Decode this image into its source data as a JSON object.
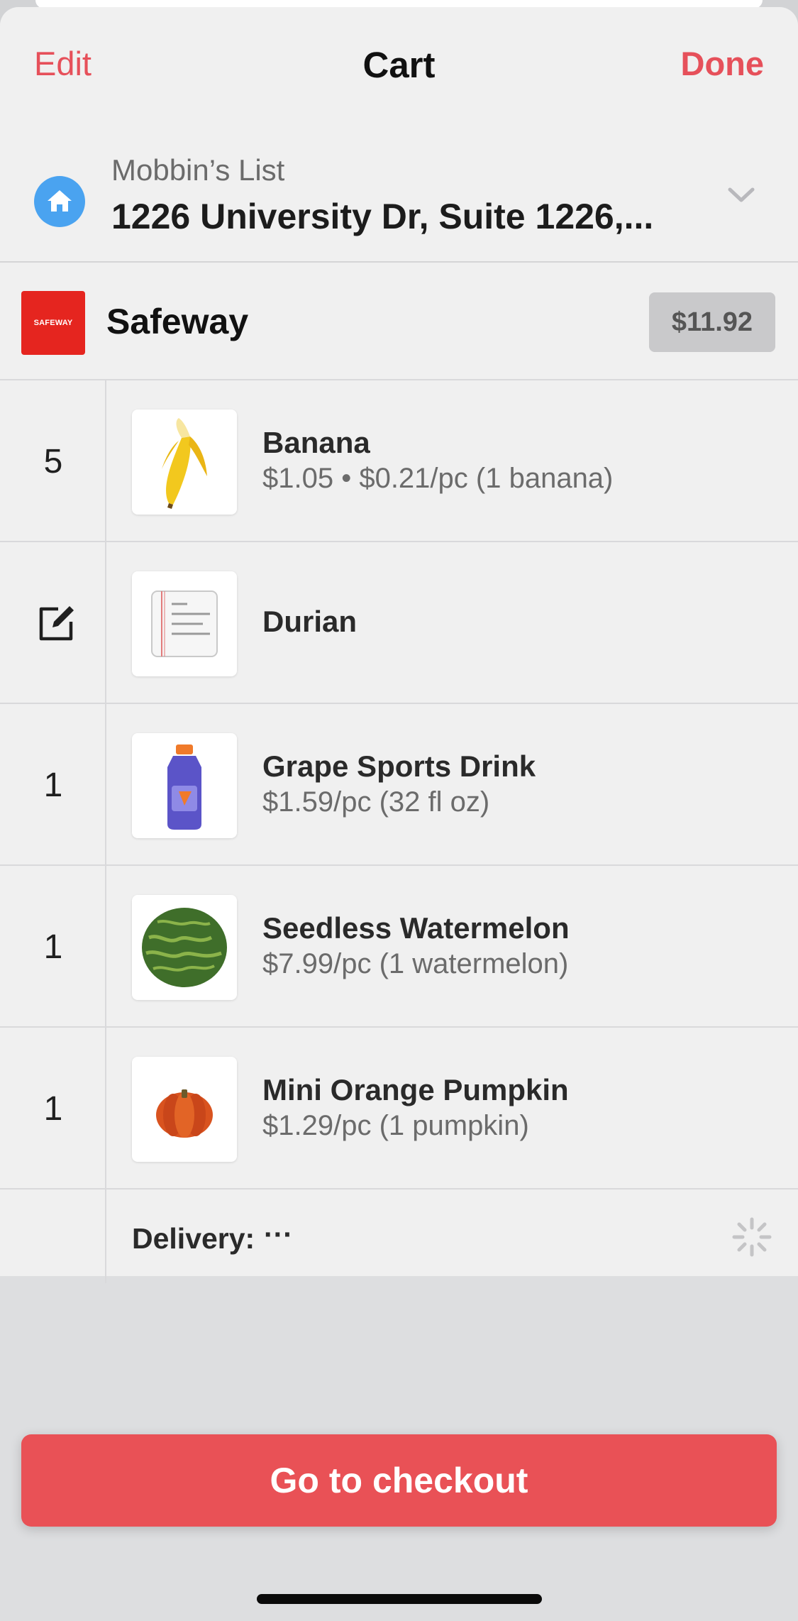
{
  "nav": {
    "edit_label": "Edit",
    "title": "Cart",
    "done_label": "Done"
  },
  "address": {
    "list_name": "Mobbin’s List",
    "address_text": "1226 University Dr, Suite 1226,...",
    "icon": "home-icon"
  },
  "store": {
    "logo_text": "SAFEWAY",
    "name": "Safeway",
    "total": "$11.92",
    "brand_color": "#e5251f"
  },
  "items": [
    {
      "qty": "5",
      "name": "Banana",
      "price": "$1.05 • $0.21/pc (1 banana)",
      "image": "banana"
    },
    {
      "qty": "",
      "name": "Durian",
      "price": "",
      "image": "notepad",
      "qty_icon": "edit-icon"
    },
    {
      "qty": "1",
      "name": "Grape Sports Drink",
      "price": "$1.59/pc (32 fl oz)",
      "image": "sports-drink-bottle"
    },
    {
      "qty": "1",
      "name": "Seedless Watermelon",
      "price": "$7.99/pc (1 watermelon)",
      "image": "watermelon"
    },
    {
      "qty": "1",
      "name": "Mini Orange Pumpkin",
      "price": "$1.29/pc (1 pumpkin)",
      "image": "pumpkin"
    }
  ],
  "delivery": {
    "label": "Delivery:",
    "value": "···"
  },
  "checkout": {
    "label": "Go to checkout",
    "color": "#e95156"
  },
  "accent_color": "#e6505a"
}
